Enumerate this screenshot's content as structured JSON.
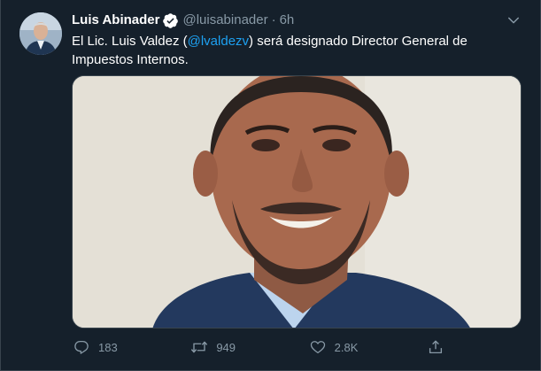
{
  "tweet": {
    "display_name": "Luis Abinader",
    "handle": "@luisabinader",
    "separator": "·",
    "time": "6h",
    "text_before": "El Lic. Luis Valdez (",
    "mention": "@lvaldezv",
    "text_after": ") será designado Director General de Impuestos Internos."
  },
  "icons": {
    "verified": "verified-badge-icon",
    "caret": "chevron-down-icon",
    "reply": "reply-icon",
    "retweet": "retweet-icon",
    "like": "heart-icon",
    "share": "share-icon"
  },
  "actions": {
    "reply_count": "183",
    "retweet_count": "949",
    "like_count": "2.8K"
  },
  "colors": {
    "background": "#15202b",
    "text_primary": "#ffffff",
    "text_secondary": "#8899a6",
    "accent": "#1da1f2",
    "border": "#38444d"
  }
}
